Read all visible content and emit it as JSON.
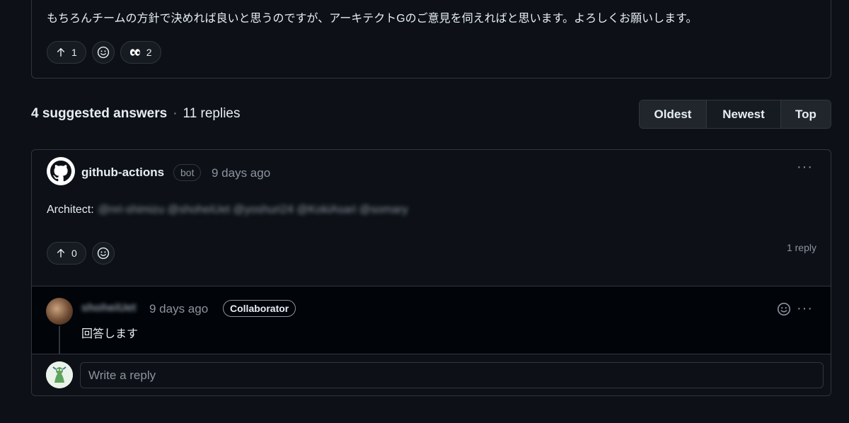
{
  "top_comment": {
    "text": "もちろんチームの方針で決めれば良いと思うのですが、アーキテクトGのご意見を伺えればと思います。よろしくお願いします。",
    "upvote_count": "1",
    "eyes_count": "2"
  },
  "answers_header": {
    "suggested": "4 suggested answers",
    "separator": "·",
    "replies": "11 replies"
  },
  "sort": {
    "oldest": "Oldest",
    "newest": "Newest",
    "top": "Top",
    "selected": "Newest"
  },
  "answer": {
    "author": "github-actions",
    "badge": "bot",
    "time": "9 days ago",
    "body_label": "Architect:",
    "body_mentions": "@nri-shimizu @shoheiUet @yoshuri24 @KokiAsari @somary",
    "upvote_count": "0",
    "reply_count": "1 reply",
    "more": "···"
  },
  "reply": {
    "author": "shoheiUet",
    "time": "9 days ago",
    "badge": "Collaborator",
    "text": "回答します",
    "more": "···"
  },
  "write_reply": {
    "placeholder": "Write a reply"
  },
  "colors": {
    "background": "#0d1117",
    "border": "#30363d",
    "muted_text": "#8b949e",
    "text": "#e6edf3",
    "reply_background": "#010409"
  }
}
